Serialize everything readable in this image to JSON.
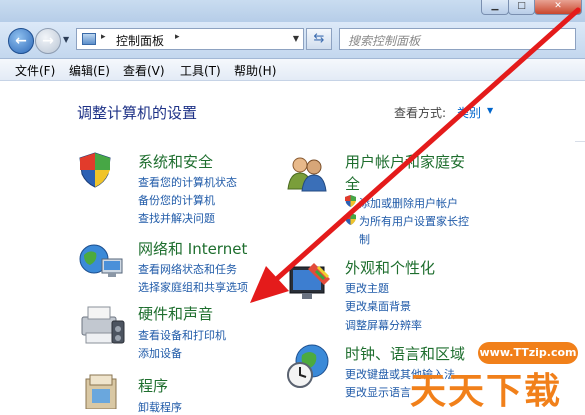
{
  "window": {
    "min_glyph": "▁",
    "max_glyph": "□",
    "close_glyph": "✕"
  },
  "nav": {
    "back_glyph": "←",
    "forward_glyph": "→",
    "address_separator": "▸",
    "address_location": "控制面板",
    "search_placeholder": "搜索控制面板"
  },
  "menu": [
    "文件(F)",
    "编辑(E)",
    "查看(V)",
    "工具(T)",
    "帮助(H)"
  ],
  "main": {
    "title": "调整计算机的设置",
    "view_by_label": "查看方式:",
    "view_by_value": "类别"
  },
  "categories": {
    "system": {
      "title": "系统和安全",
      "links": [
        "查看您的计算机状态",
        "备份您的计算机",
        "查找并解决问题"
      ]
    },
    "network": {
      "title": "网络和 Internet",
      "links": [
        "查看网络状态和任务",
        "选择家庭组和共享选项"
      ]
    },
    "hardware": {
      "title": "硬件和声音",
      "links": [
        "查看设备和打印机",
        "添加设备"
      ]
    },
    "programs": {
      "title": "程序",
      "links": [
        "卸载程序"
      ]
    },
    "users": {
      "title_line1": "用户帐户和家庭安",
      "title_line2": "全",
      "links": [
        "添加或删除用户帐户",
        "为所有用户设置家长控",
        "制"
      ]
    },
    "appearance": {
      "title": "外观和个性化",
      "links": [
        "更改主题",
        "更改桌面背景",
        "调整屏幕分辨率"
      ]
    },
    "clock": {
      "title": "时钟、语言和区域",
      "links": [
        "更改键盘或其他输入法",
        "更改显示语言"
      ]
    }
  },
  "watermark": {
    "site": "www.TTzip.com",
    "brand": "天天下载"
  },
  "colors": {
    "category_title": "#1e6e2e",
    "link": "#1f5aa8",
    "arrow": "#e41b1b",
    "watermark": "#f1801a"
  }
}
